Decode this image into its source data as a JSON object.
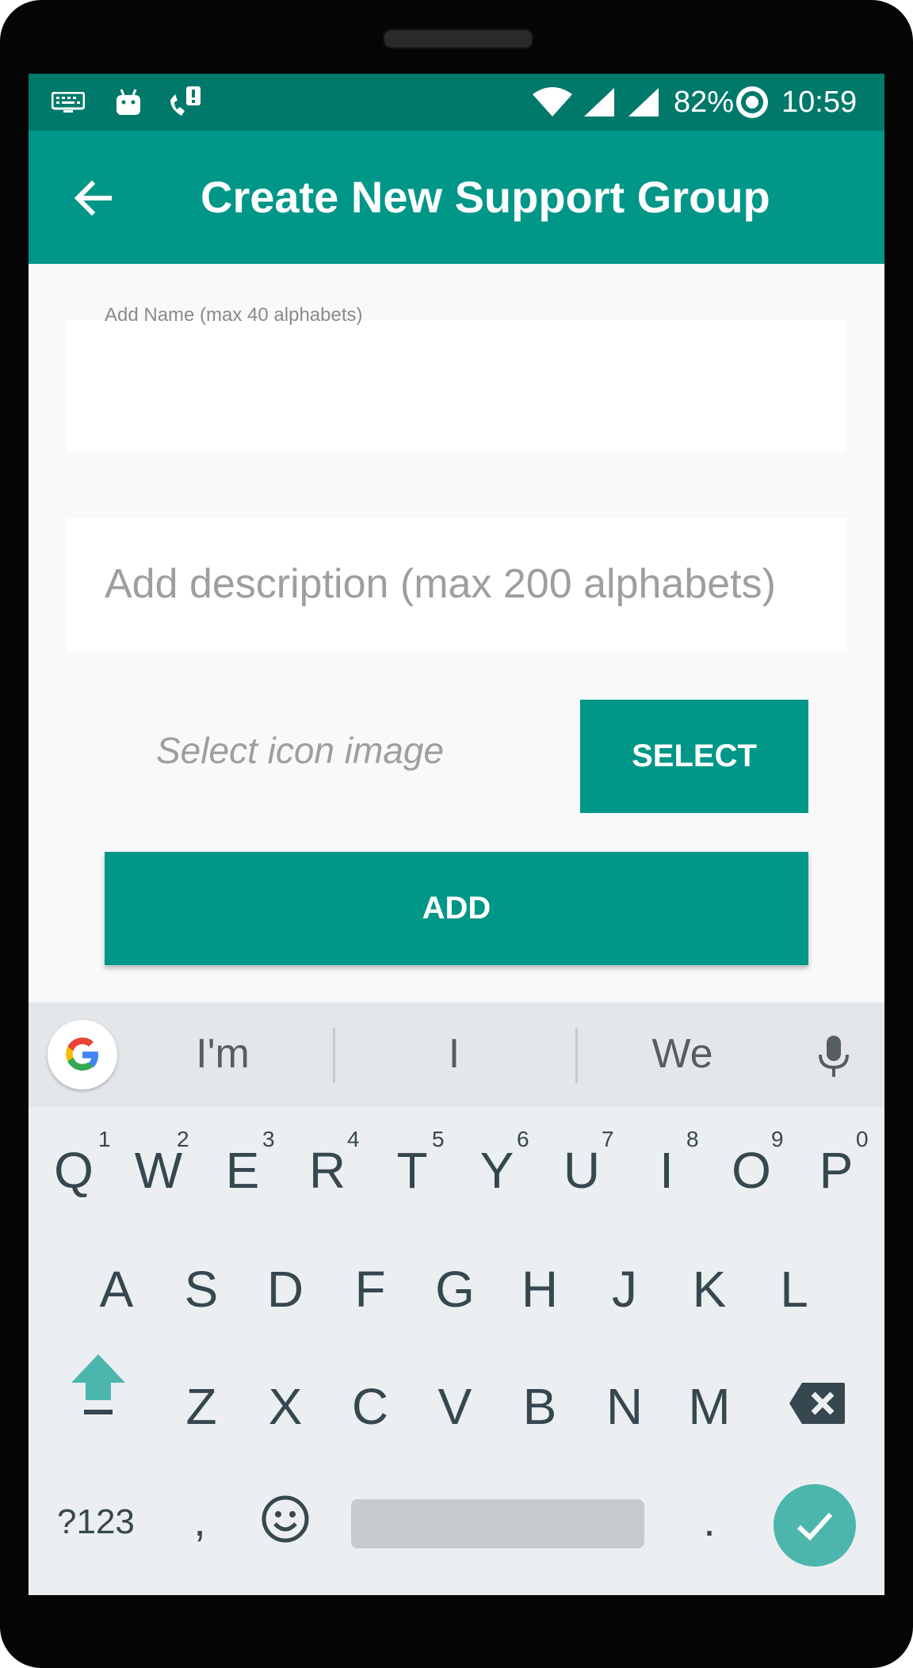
{
  "status_bar": {
    "battery": "82%",
    "time": "10:59",
    "icons": [
      "keyboard-icon",
      "android-icon",
      "phone-alert-icon",
      "wifi-icon",
      "signal-icon",
      "signal-icon-2",
      "battery-icon"
    ]
  },
  "app_bar": {
    "title": "Create New Support Group",
    "back_icon": "arrow-back-icon"
  },
  "form": {
    "name_label": "Add Name (max 40 alphabets)",
    "name_value": "",
    "description_placeholder": "Add description (max 200 alphabets)",
    "icon_placeholder": "Select icon image",
    "select_label": "SELECT",
    "add_label": "ADD"
  },
  "keyboard": {
    "suggestions": [
      "I'm",
      "I",
      "We"
    ],
    "row1": [
      {
        "key": "Q",
        "hint": "1"
      },
      {
        "key": "W",
        "hint": "2"
      },
      {
        "key": "E",
        "hint": "3"
      },
      {
        "key": "R",
        "hint": "4"
      },
      {
        "key": "T",
        "hint": "5"
      },
      {
        "key": "Y",
        "hint": "6"
      },
      {
        "key": "U",
        "hint": "7"
      },
      {
        "key": "I",
        "hint": "8"
      },
      {
        "key": "O",
        "hint": "9"
      },
      {
        "key": "P",
        "hint": "0"
      }
    ],
    "row2": [
      "A",
      "S",
      "D",
      "F",
      "G",
      "H",
      "J",
      "K",
      "L"
    ],
    "row3": [
      "Z",
      "X",
      "C",
      "V",
      "B",
      "N",
      "M"
    ],
    "symbols_label": "?123",
    "comma": ",",
    "period": ".",
    "colors": {
      "accent": "#4db6ac",
      "key_text": "#37474f"
    }
  },
  "colors": {
    "primary": "#009688",
    "primary_dark": "#00796b",
    "background": "#f9f9f9"
  }
}
